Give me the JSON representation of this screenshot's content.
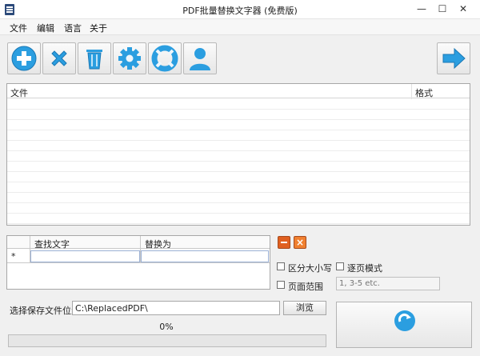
{
  "window": {
    "title": "PDF批量替换文字器 (免费版)",
    "minimize": "—",
    "maximize": "☐",
    "close": "✕"
  },
  "menu": [
    "文件",
    "编辑",
    "语言",
    "关于"
  ],
  "toolbar": {
    "add_icon": "plus-circle-icon",
    "remove_icon": "x-icon",
    "clear_icon": "trash-icon",
    "settings_icon": "gear-icon",
    "help_icon": "lifebuoy-icon",
    "account_icon": "user-icon",
    "next_icon": "arrow-right-icon",
    "accent_color": "#2b9ee0"
  },
  "file_list": {
    "columns": [
      "文件",
      "格式"
    ],
    "rows": []
  },
  "rules": {
    "columns": [
      "查找文字",
      "替换为"
    ],
    "new_row_marker": "*",
    "rows": [
      {
        "find": "",
        "replace": ""
      }
    ]
  },
  "options": {
    "match_case_label": "区分大小写",
    "match_case": false,
    "page_mode_label": "逐页模式",
    "page_mode": false,
    "page_range_label": "页面范围",
    "page_range": false,
    "page_range_placeholder": "1, 3-5 etc."
  },
  "output": {
    "save_location_label": "选择保存文件位置",
    "save_path": "C:\\ReplacedPDF\\",
    "browse_label": "浏览"
  },
  "progress": {
    "text": "0%",
    "value": 0
  },
  "start_button": {
    "icon": "replace-start-icon"
  }
}
